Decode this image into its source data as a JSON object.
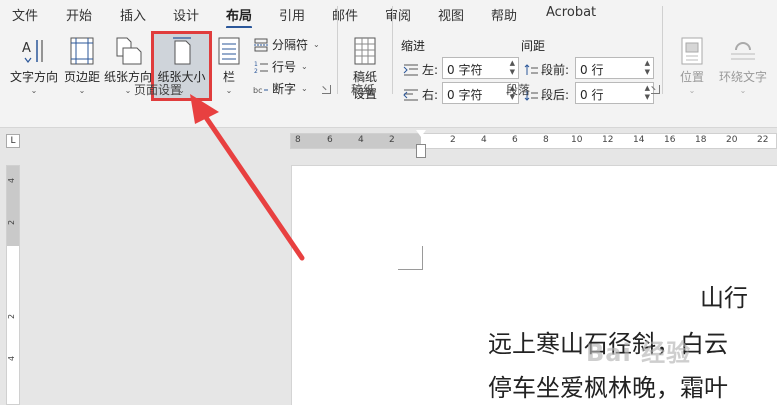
{
  "tabs": [
    "文件",
    "开始",
    "插入",
    "设计",
    "布局",
    "引用",
    "邮件",
    "审阅",
    "视图",
    "帮助",
    "Acrobat"
  ],
  "active_tab": "布局",
  "page_setup": {
    "text_direction": "文字方向",
    "margins": "页边距",
    "orientation": "纸张方向",
    "size": "纸张大小",
    "columns": "栏",
    "breaks": "分隔符",
    "line_numbers": "行号",
    "hyphenation": "断字",
    "group_label": "页面设置"
  },
  "manuscript": {
    "button": "稿纸设置",
    "button_line1": "稿纸",
    "button_line2": "设置",
    "group_label": "稿纸"
  },
  "paragraph": {
    "indent_heading": "缩进",
    "spacing_heading": "间距",
    "left_label": "左:",
    "left_value": "0 字符",
    "right_label": "右:",
    "right_value": "0 字符",
    "before_label": "段前:",
    "before_value": "0 行",
    "after_label": "段后:",
    "after_value": "0 行",
    "group_label": "段落"
  },
  "arrange": {
    "position": "位置",
    "wrap_text": "环绕文字"
  },
  "ruler": {
    "horizontal_ticks": [
      "8",
      "6",
      "4",
      "2",
      "2",
      "4",
      "6",
      "8",
      "10",
      "12",
      "14",
      "16",
      "18",
      "20",
      "22"
    ],
    "vertical_ticks": [
      "4",
      "2",
      "2",
      "4"
    ],
    "corner_tab": "L"
  },
  "document": {
    "title": "山行",
    "line1": "远上寒山石径斜，白云",
    "line2": "停车坐爱枫林晚，霜叶"
  },
  "watermark_text": "Bai 经验",
  "colors": {
    "highlight_border": "#e03c3c",
    "arrow": "#e84040",
    "accent": "#2b579a"
  }
}
